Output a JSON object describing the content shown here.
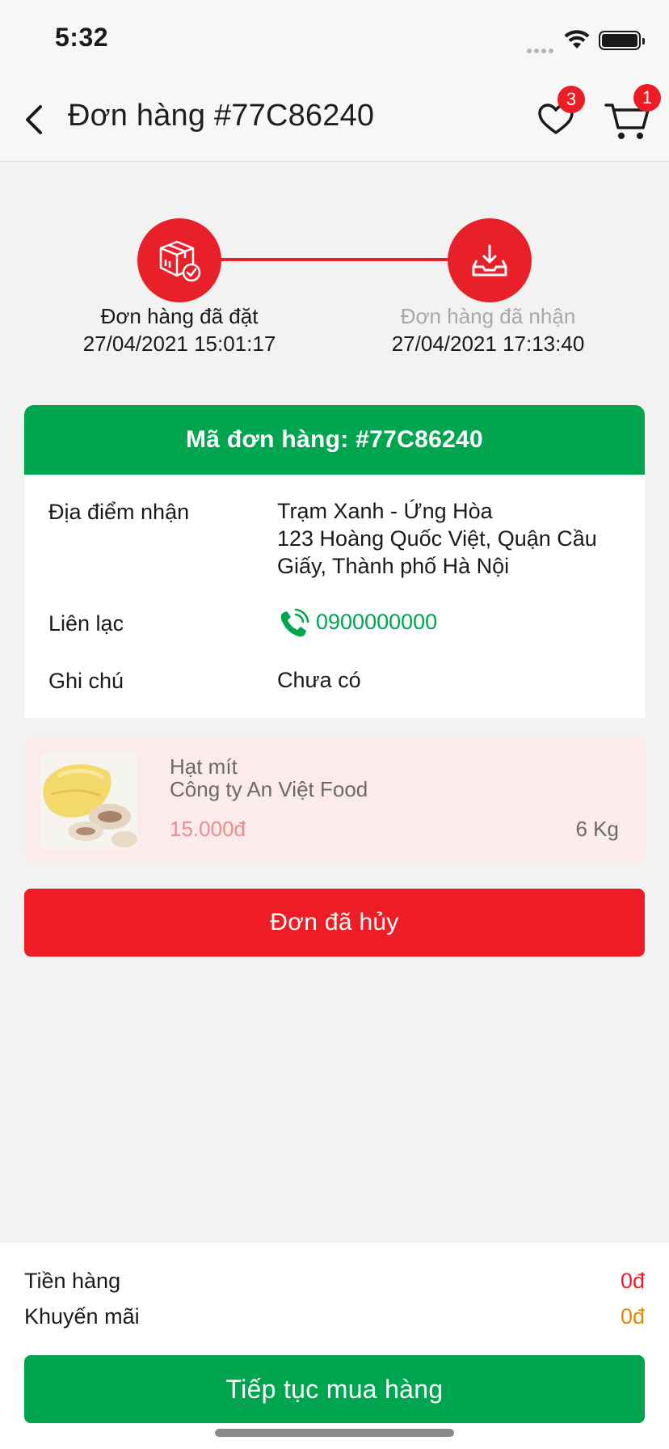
{
  "status_bar": {
    "time": "5:32"
  },
  "header": {
    "title": "Đơn hàng #77C86240",
    "favorites_count": "3",
    "cart_count": "1"
  },
  "tracker": {
    "steps": [
      {
        "label": "Đơn hàng đã đặt",
        "date": "27/04/2021 15:01:17"
      },
      {
        "label": "Đơn hàng đã nhận",
        "date": "27/04/2021 17:13:40"
      }
    ]
  },
  "order": {
    "code_label": "Mã đơn hàng: #77C86240",
    "pickup_label": "Địa điểm nhận",
    "pickup_line1": "Trạm Xanh - Ứng Hòa",
    "pickup_line2": "123 Hoàng Quốc Việt, Quận Cầu",
    "pickup_line3": "Giấy, Thành phố Hà Nội",
    "contact_label": "Liên lạc",
    "contact_value": "0900000000",
    "note_label": "Ghi chú",
    "note_value": "Chưa có"
  },
  "product": {
    "name": "Hạt mít",
    "vendor": "Công ty An Việt Food",
    "price": "15.000đ",
    "quantity": "6 Kg"
  },
  "cancel_label": "Đơn đã hủy",
  "summary": {
    "goods_label": "Tiền hàng",
    "goods_value": "0đ",
    "promo_label": "Khuyến mãi",
    "promo_value": "0đ"
  },
  "continue_label": "Tiếp tục mua hàng",
  "colors": {
    "brand_green": "#00a550",
    "brand_red": "#ee1c25",
    "promo_orange": "#e08a00"
  }
}
